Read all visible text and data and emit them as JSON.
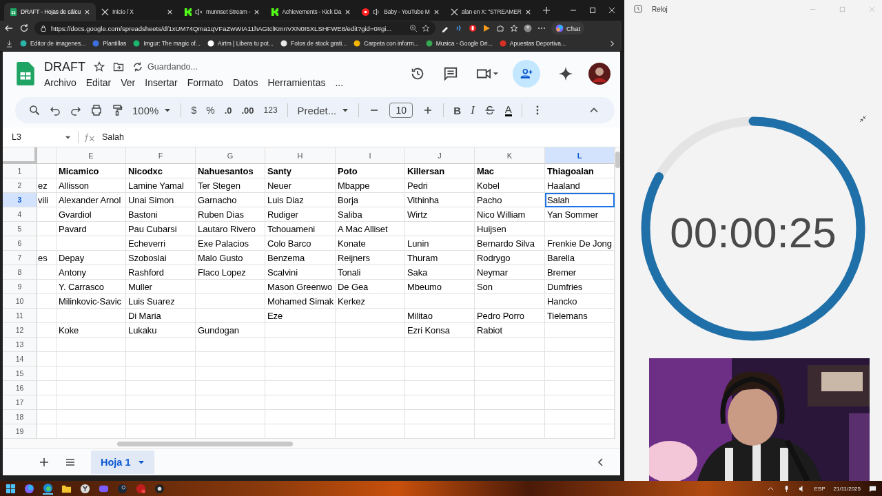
{
  "browser": {
    "tabs": [
      {
        "title": "DRAFT - Hojas de cálcu",
        "kind": "sheets",
        "audio": false,
        "muted": false,
        "selected": true
      },
      {
        "title": "Inicio / X",
        "kind": "x",
        "audio": false,
        "muted": false,
        "selected": false
      },
      {
        "title": "munnset Stream -",
        "kind": "kick",
        "audio": true,
        "muted": true,
        "selected": false
      },
      {
        "title": "Achievements - Kick Da",
        "kind": "kick",
        "audio": false,
        "muted": false,
        "selected": false
      },
      {
        "title": "Baby - YouTube M",
        "kind": "youtube",
        "audio": true,
        "muted": false,
        "selected": false
      },
      {
        "title": "alan en X: \"STREAMER",
        "kind": "x",
        "audio": false,
        "muted": false,
        "selected": false
      }
    ],
    "url": "https://docs.google.com/spreadsheets/d/1xUM74Qma1qVFaZwWIA11hAGtclKmnVXN0I5XLSHFWE8/edit?gid=0#gi...",
    "chat_button": "Chat",
    "bookmarks": [
      {
        "label": "Editor de imagenes...",
        "color": "#2bb5a8"
      },
      {
        "label": "Plantillas",
        "color": "#3d6fe0"
      },
      {
        "label": "Imgur: The magic of...",
        "color": "#1bb76e"
      },
      {
        "label": "Airtm | Libera tu pot...",
        "color": "#ffffff"
      },
      {
        "label": "Fotos de stock grati...",
        "color": "#e8e8e8"
      },
      {
        "label": "Carpeta con inform...",
        "color": "#f4b400"
      },
      {
        "label": "Musica - Google Dri...",
        "color": "#34a853"
      },
      {
        "label": "Apuestas Deportiva...",
        "color": "#d93025"
      }
    ]
  },
  "sheets": {
    "doc_title": "DRAFT",
    "save_status": "Guardando...",
    "menu": [
      "Archivo",
      "Editar",
      "Ver",
      "Insertar",
      "Formato",
      "Datos",
      "Herramientas",
      "..."
    ],
    "toolbar": {
      "zoom": "100%",
      "currency": "$",
      "percent": "%",
      "decrease_decimals": ".0",
      "increase_decimals": ".00",
      "number_format": "123",
      "font": "Predet...",
      "font_size": "10",
      "bold": "B",
      "italic": "I",
      "text_color": "A"
    },
    "formula_bar": {
      "cell": "L3",
      "value": "Salah"
    },
    "columns": [
      {
        "selected": false
      },
      {
        "label": "E",
        "selected": false
      },
      {
        "label": "F",
        "selected": false
      },
      {
        "label": "G",
        "selected": false
      },
      {
        "label": "H",
        "selected": false
      },
      {
        "label": "I",
        "selected": false
      },
      {
        "label": "J",
        "selected": false
      },
      {
        "label": "K",
        "selected": false
      },
      {
        "label": "L",
        "selected": true
      }
    ],
    "rows": [
      {
        "number": "1",
        "kind": "header",
        "selected": false,
        "cells": [
          null,
          "Micamico",
          "Nicodxc",
          "Nahuesantos",
          "Santy",
          "Poto",
          "Killersan",
          "Mac",
          "Thiagoalan"
        ]
      },
      {
        "number": "2",
        "kind": "data",
        "selected": false,
        "cells": [
          "ez",
          "Allisson",
          "Lamine Yamal",
          "Ter Stegen",
          "Neuer",
          "Mbappe",
          "Pedri",
          "Kobel",
          "Haaland"
        ]
      },
      {
        "number": "3",
        "kind": "data",
        "selected": true,
        "cells": [
          "vili",
          "Alexander Arnol",
          "Unai Simon",
          "Garnacho",
          "Luis Diaz",
          "Borja",
          "Vithinha",
          "Pacho",
          "Salah"
        ]
      },
      {
        "number": "4",
        "kind": "data",
        "selected": false,
        "cells": [
          null,
          "Gvardiol",
          "Bastoni",
          "Ruben Dias",
          "Rudiger",
          "Saliba",
          "Wirtz",
          "Nico William",
          "Yan Sommer"
        ]
      },
      {
        "number": "5",
        "kind": "data",
        "selected": false,
        "cells": [
          null,
          "Pavard",
          "Pau Cubarsi",
          "Lautaro Rivero",
          "Tchouameni",
          "A Mac Alliset",
          null,
          "Huijsen",
          null
        ]
      },
      {
        "number": "6",
        "kind": "data",
        "selected": false,
        "cells": [
          null,
          null,
          "Echeverri",
          "Exe Palacios",
          "Colo Barco",
          "Konate",
          "Lunin",
          "Bernardo Silva",
          "Frenkie De Jong"
        ]
      },
      {
        "number": "7",
        "kind": "data",
        "selected": false,
        "cells": [
          "es",
          "Depay",
          "Szoboslai",
          "Malo Gusto",
          "Benzema",
          "Reijners",
          "Thuram",
          "Rodrygo",
          "Barella"
        ]
      },
      {
        "number": "8",
        "kind": "data",
        "selected": false,
        "cells": [
          null,
          "Antony",
          "Rashford",
          "Flaco Lopez",
          "Scalvini",
          "Tonali",
          "Saka",
          "Neymar",
          "Bremer"
        ]
      },
      {
        "number": "9",
        "kind": "data",
        "selected": false,
        "cells": [
          null,
          "Y. Carrasco",
          "Muller",
          null,
          "Mason Greenwo",
          "De Gea",
          "Mbeumo",
          "Son",
          "Dumfries"
        ]
      },
      {
        "number": "10",
        "kind": "data",
        "selected": false,
        "cells": [
          null,
          "Milinkovic-Savic",
          "Luis Suarez",
          null,
          "Mohamed Simak",
          "Kerkez",
          null,
          null,
          "Hancko"
        ]
      },
      {
        "number": "11",
        "kind": "data",
        "selected": false,
        "cells": [
          null,
          null,
          "Di Maria",
          null,
          "Eze",
          null,
          "Militao",
          "Pedro Porro",
          "Tielemans"
        ]
      },
      {
        "number": "12",
        "kind": "data",
        "selected": false,
        "cells": [
          null,
          "Koke",
          "Lukaku",
          "Gundogan",
          null,
          null,
          "Ezri Konsa",
          "Rabiot",
          null
        ]
      },
      {
        "number": "13",
        "kind": "data",
        "selected": false
      },
      {
        "number": "14",
        "kind": "data",
        "selected": false
      },
      {
        "number": "15",
        "kind": "data",
        "selected": false
      },
      {
        "number": "16",
        "kind": "data",
        "selected": false
      },
      {
        "number": "17",
        "kind": "data",
        "selected": false
      },
      {
        "number": "18",
        "kind": "data",
        "selected": false
      },
      {
        "number": "19",
        "kind": "data",
        "selected": false
      }
    ],
    "sheet_tabs": [
      {
        "label": "Hoja 1",
        "selected": true
      }
    ]
  },
  "clock": {
    "title": "Reloj",
    "time": "00:00:25",
    "level": 0.83
  },
  "taskbar": {
    "language": "ESP",
    "date": "21/11/2025"
  }
}
